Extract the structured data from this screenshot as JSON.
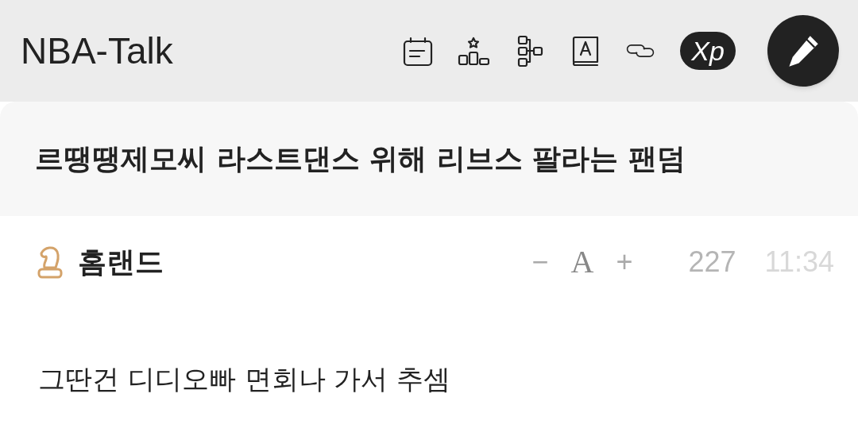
{
  "app_title": "NBA-Talk",
  "toolbar": {
    "xp_badge": "Xp"
  },
  "post": {
    "title": "르땡땡제모씨 라스트댄스 위해 리브스 팔라는 팬덤",
    "author": "홈랜드",
    "font_controls": {
      "decrease": "−",
      "font": "A",
      "increase": "+"
    },
    "views": "227",
    "time": "11:34",
    "body": "그딴건 디디오빠 면회나 가서 추셈"
  }
}
